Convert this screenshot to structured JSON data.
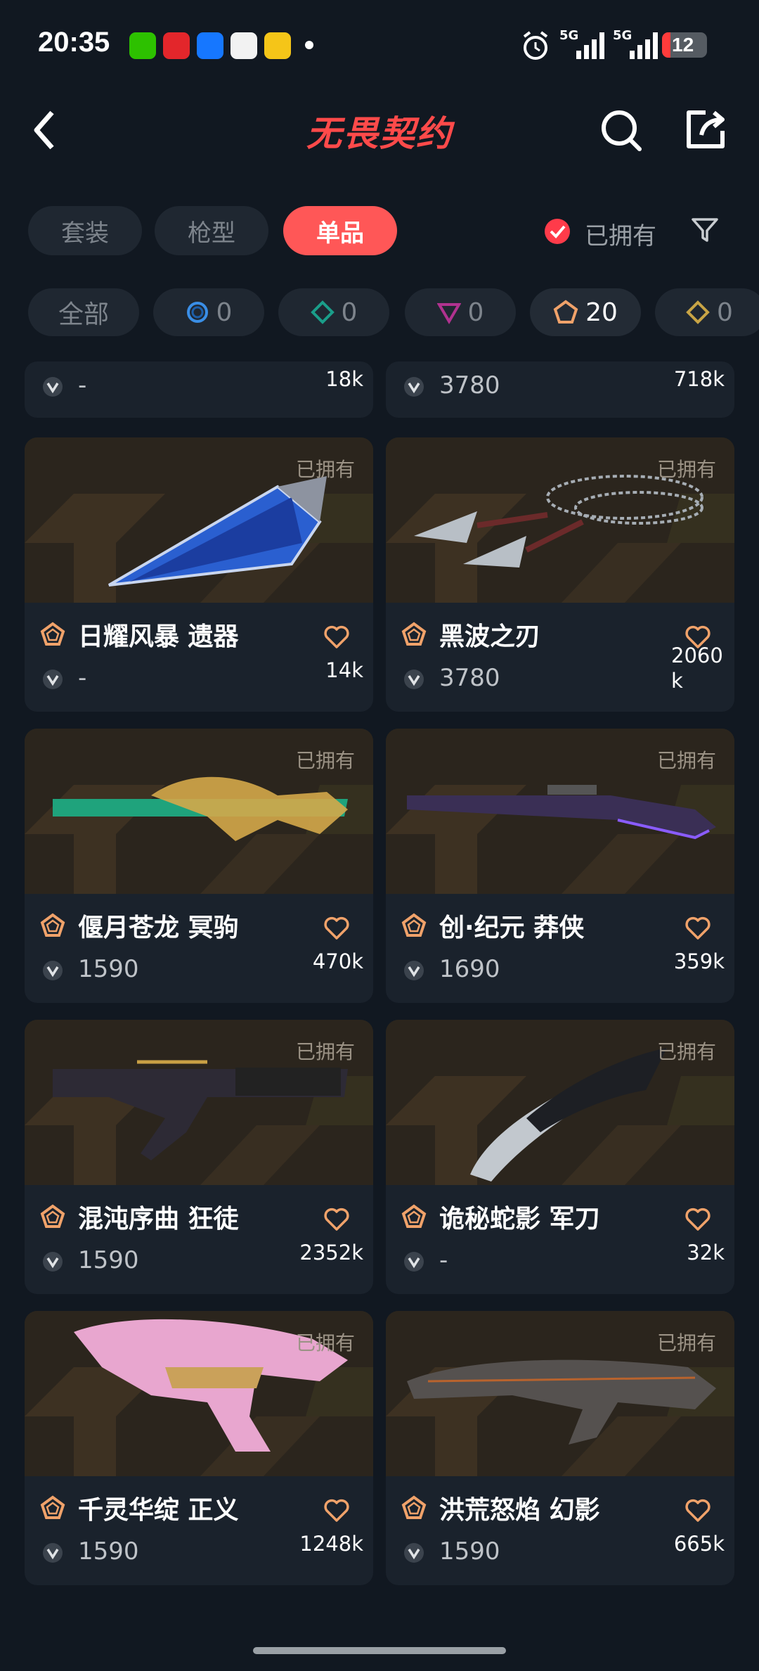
{
  "status_bar": {
    "time": "20:35",
    "battery": "12",
    "network_1": "5G",
    "network_2": "5G",
    "notification_icons": [
      "wechat-icon",
      "netease-music-icon",
      "alipay-icon",
      "app-icon",
      "app-yellow-icon"
    ]
  },
  "header": {
    "title": "无畏契约",
    "back_icon": "back-arrow-icon",
    "search_icon": "search-icon",
    "share_icon": "share-icon"
  },
  "type_tabs": [
    {
      "label": "套装",
      "active": false
    },
    {
      "label": "枪型",
      "active": false
    },
    {
      "label": "单品",
      "active": true
    }
  ],
  "owned_filter": {
    "label": "已拥有",
    "checked": true
  },
  "rarity_filters": [
    {
      "label": "全部",
      "count": ""
    },
    {
      "icon": "blue-circle-icon",
      "count": "0"
    },
    {
      "icon": "teal-diamond-icon",
      "count": "0"
    },
    {
      "icon": "purple-triangle-icon",
      "count": "0"
    },
    {
      "icon": "orange-pentagon-icon",
      "count": "20",
      "active": true
    },
    {
      "icon": "gold-diamond-icon",
      "count": "0"
    }
  ],
  "partial_row": [
    {
      "price": "-",
      "count": "18k"
    },
    {
      "price": "3780",
      "count": "718k"
    }
  ],
  "cards": [
    {
      "name": "日耀风暴 遗器",
      "owned": "已拥有",
      "price": "-",
      "count": "14k"
    },
    {
      "name": "黑波之刃",
      "owned": "已拥有",
      "price": "3780",
      "count": "2060\nk"
    },
    {
      "name": "偃月苍龙 冥驹",
      "owned": "已拥有",
      "price": "1590",
      "count": "470k"
    },
    {
      "name": "创·纪元 莽侠",
      "owned": "已拥有",
      "price": "1690",
      "count": "359k"
    },
    {
      "name": "混沌序曲 狂徒",
      "owned": "已拥有",
      "price": "1590",
      "count": "2352k"
    },
    {
      "name": "诡秘蛇影 军刀",
      "owned": "已拥有",
      "price": "-",
      "count": "32k"
    },
    {
      "name": "千灵华绽 正义",
      "owned": "已拥有",
      "price": "1590",
      "count": "1248k"
    },
    {
      "name": "洪荒怒焰 幻影",
      "owned": "已拥有",
      "price": "1590",
      "count": "665k"
    }
  ],
  "colors": {
    "background": "#111821",
    "card": "#1a222c",
    "accent": "#ff5757",
    "tier_orange": "#e8884a",
    "heart": "#f0a26a"
  }
}
